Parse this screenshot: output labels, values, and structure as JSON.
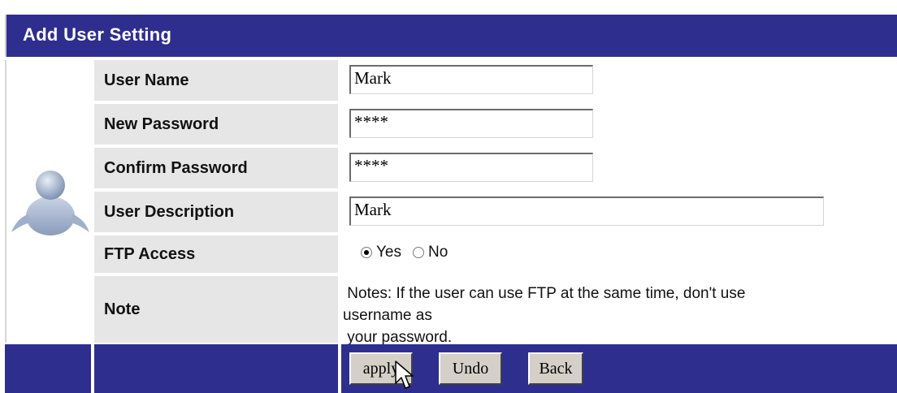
{
  "title": "Add User Setting",
  "fields": {
    "user_name": {
      "label": "User Name",
      "value": "Mark"
    },
    "new_password": {
      "label": "New Password",
      "value": "****"
    },
    "confirm_password": {
      "label": "Confirm Password",
      "value": "****"
    },
    "user_description": {
      "label": "User Description",
      "value": "Mark"
    }
  },
  "ftp_access": {
    "label": "FTP Access",
    "options": [
      "Yes",
      "No"
    ],
    "selected": "Yes"
  },
  "note": {
    "label": "Note",
    "line1": " Notes: If the user can use FTP at the same time, don't use",
    "line2": "username as",
    "line3": " your password."
  },
  "buttons": {
    "apply": "apply",
    "undo": "Undo",
    "back": "Back"
  },
  "icons": {
    "avatar": "user-avatar-icon",
    "cursor": "mouse-pointer-icon"
  },
  "colors": {
    "header_bg": "#2e2e8f",
    "label_bg": "#e6e6e6",
    "button_bg": "#d4d0c8"
  }
}
